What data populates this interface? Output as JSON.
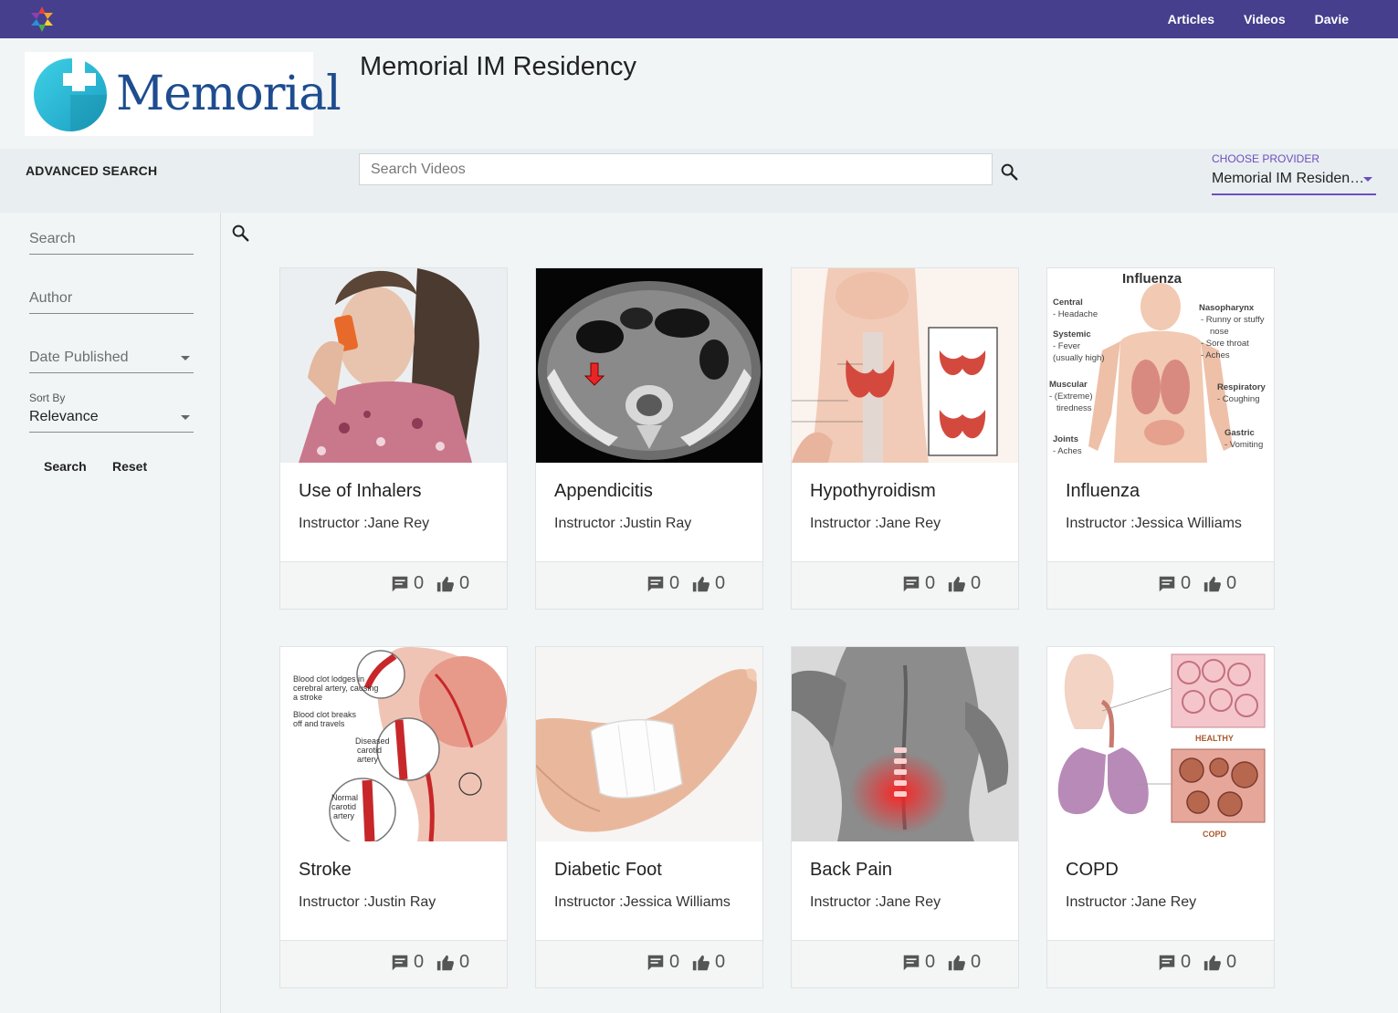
{
  "nav": {
    "links": [
      "Articles",
      "Videos",
      "Davie"
    ]
  },
  "header": {
    "brand_text": "Memorial",
    "page_title": "Memorial IM Residency"
  },
  "search_strip": {
    "advanced_label": "ADVANCED SEARCH",
    "search_placeholder": "Search Videos",
    "provider_label": "CHOOSE PROVIDER",
    "provider_value": "Memorial IM Residen…"
  },
  "sidebar": {
    "search_placeholder": "Search",
    "author_placeholder": "Author",
    "date_label": "Date Published",
    "sort_label": "Sort By",
    "sort_value": "Relevance",
    "search_button": "Search",
    "reset_button": "Reset"
  },
  "cards": [
    {
      "title": "Use of Inhalers",
      "instructor": "Instructor :Jane Rey",
      "comments": "0",
      "likes": "0",
      "image": "inhaler-photo"
    },
    {
      "title": "Appendicitis",
      "instructor": "Instructor :Justin Ray",
      "comments": "0",
      "likes": "0",
      "image": "ct-scan"
    },
    {
      "title": "Hypothyroidism",
      "instructor": "Instructor :Jane Rey",
      "comments": "0",
      "likes": "0",
      "image": "thyroid-diagram"
    },
    {
      "title": "Influenza",
      "instructor": "Instructor :Jessica Williams",
      "comments": "0",
      "likes": "0",
      "image": "influenza-diagram"
    },
    {
      "title": "Stroke",
      "instructor": "Instructor :Justin Ray",
      "comments": "0",
      "likes": "0",
      "image": "stroke-diagram"
    },
    {
      "title": "Diabetic Foot",
      "instructor": "Instructor :Jessica Williams",
      "comments": "0",
      "likes": "0",
      "image": "foot-photo"
    },
    {
      "title": "Back Pain",
      "instructor": "Instructor :Jane Rey",
      "comments": "0",
      "likes": "0",
      "image": "back-photo"
    },
    {
      "title": "COPD",
      "instructor": "Instructor :Jane Rey",
      "comments": "0",
      "likes": "0",
      "image": "lung-diagram"
    }
  ],
  "image_text": {
    "influenza": {
      "title": "Influenza",
      "labels": [
        "Central",
        "- Headache",
        "Systemic",
        "- Fever",
        "(usually high)",
        "Muscular",
        "- (Extreme)",
        "tiredness",
        "Joints",
        "- Aches",
        "Nasopharynx",
        "- Runny or stuffy",
        "nose",
        "- Sore throat",
        "- Aches",
        "Respiratory",
        "- Coughing",
        "Gastric",
        "- Vomiting"
      ]
    },
    "stroke": {
      "labels": [
        "Blood clot lodges in",
        "cerebral artery, causing",
        "a stroke",
        "Blood clot breaks",
        "off and travels",
        "Diseased",
        "carotid",
        "artery",
        "Normal",
        "carotid",
        "artery"
      ]
    },
    "copd": {
      "labels": [
        "HEALTHY",
        "COPD"
      ]
    }
  },
  "colors": {
    "nav_bg": "#463f8e",
    "accent": "#6c4fbf",
    "brand_blue": "#1e4c8f",
    "brand_teal": "#2bb7d4"
  }
}
